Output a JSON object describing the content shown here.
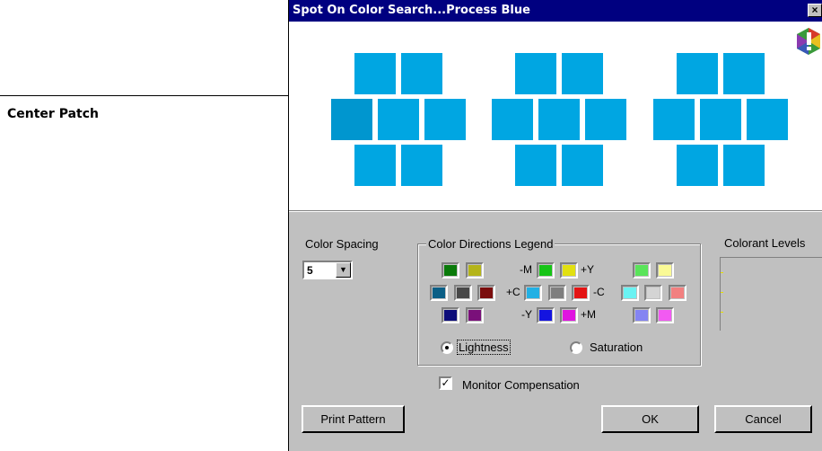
{
  "callout": {
    "label": "Center Patch"
  },
  "window": {
    "title": "Spot On Color Search...Process Blue",
    "close_glyph": "×"
  },
  "colors": {
    "patch": "#00a6e2",
    "patch_center_left": "#0096cf",
    "titlebar": "#000080",
    "dialog_bg": "#c0c0c0"
  },
  "color_spacing": {
    "label": "Color Spacing",
    "value": "5"
  },
  "legend": {
    "title": "Color Directions Legend",
    "labels": {
      "minus_m": "-M",
      "plus_y": "+Y",
      "plus_c": "+C",
      "minus_c": "-C",
      "minus_y": "-Y",
      "plus_m": "+M"
    },
    "radios": {
      "lightness": "Lightness",
      "saturation": "Saturation",
      "selected": "Lightness"
    }
  },
  "colorant_levels": {
    "label": "Colorant Levels"
  },
  "monitor_compensation": {
    "label": "Monitor Compensation",
    "checked": true
  },
  "buttons": {
    "print_pattern": "Print Pattern",
    "ok": "OK",
    "cancel": "Cancel"
  },
  "icons": {
    "close": "close-icon",
    "warning": "warning-hexagon-icon",
    "dropdown": "chevron-down-icon",
    "check": "check-icon"
  }
}
